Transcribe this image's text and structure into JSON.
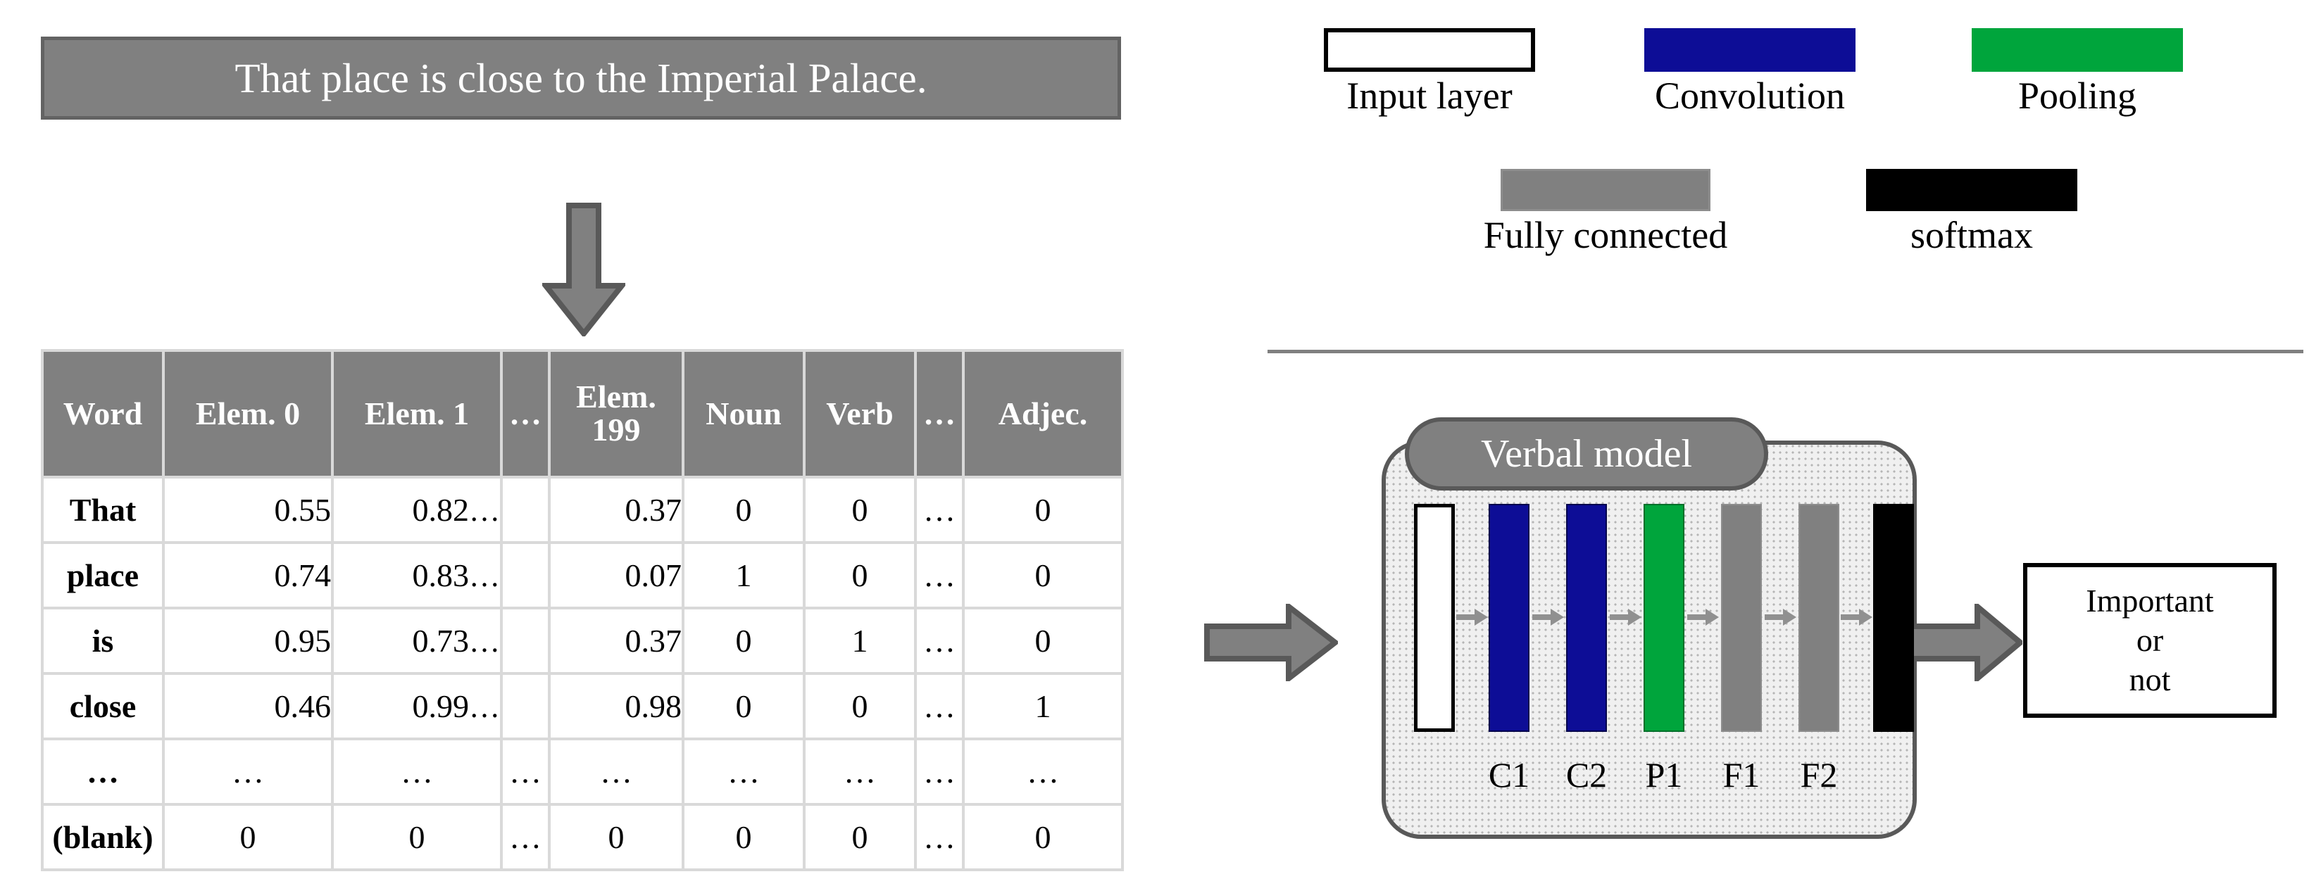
{
  "sentence_box": {
    "text": "That place is close to the Imperial Palace."
  },
  "flow_arrows": {
    "down_arrow": "down-arrow",
    "input_arrow": "right-arrow",
    "output_arrow": "right-arrow"
  },
  "table": {
    "headers": [
      "Word",
      "Elem. 0",
      "Elem. 1",
      "…",
      "Elem. 199",
      "Noun",
      "Verb",
      "…",
      "Adjec."
    ],
    "rows": [
      {
        "word": "That",
        "elem0": "0.55",
        "elem1": "0.82",
        "dots1": "…",
        "elem199": "0.37",
        "noun": "0",
        "verb": "0",
        "dots2": "…",
        "adjec": "0"
      },
      {
        "word": "place",
        "elem0": "0.74",
        "elem1": "0.83",
        "dots1": "…",
        "elem199": "0.07",
        "noun": "1",
        "verb": "0",
        "dots2": "…",
        "adjec": "0"
      },
      {
        "word": "is",
        "elem0": "0.95",
        "elem1": "0.73",
        "dots1": "…",
        "elem199": "0.37",
        "noun": "0",
        "verb": "1",
        "dots2": "…",
        "adjec": "0"
      },
      {
        "word": "close",
        "elem0": "0.46",
        "elem1": "0.99",
        "dots1": "…",
        "elem199": "0.98",
        "noun": "0",
        "verb": "0",
        "dots2": "…",
        "adjec": "1"
      },
      {
        "word": "…",
        "elem0": "…",
        "elem1": "…",
        "dots1": "…",
        "elem199": "…",
        "noun": "…",
        "verb": "…",
        "dots2": "…",
        "adjec": "…"
      },
      {
        "word": "(blank)",
        "elem0": "0",
        "elem1": "0",
        "dots1": "…",
        "elem199": "0",
        "noun": "0",
        "verb": "0",
        "dots2": "…",
        "adjec": "0"
      }
    ],
    "elem1_trailing_dots": "…"
  },
  "legend": {
    "items": [
      {
        "label": "Input layer",
        "color": "#ffffff",
        "swatch": "input-layer-swatch"
      },
      {
        "label": "Convolution",
        "color": "#0d0d96",
        "swatch": "convolution-swatch"
      },
      {
        "label": "Pooling",
        "color": "#00a53c",
        "swatch": "pooling-swatch"
      },
      {
        "label": "Fully connected",
        "color": "#808080",
        "swatch": "fully-connected-swatch"
      },
      {
        "label": "softmax",
        "color": "#000000",
        "swatch": "softmax-swatch"
      }
    ]
  },
  "model": {
    "title": "Verbal model",
    "layers": [
      {
        "name": "Input layer",
        "label": "",
        "color": "#ffffff"
      },
      {
        "name": "Convolution 1",
        "label": "C1",
        "color": "#0d0d96"
      },
      {
        "name": "Convolution 2",
        "label": "C2",
        "color": "#0d0d96"
      },
      {
        "name": "Pooling 1",
        "label": "P1",
        "color": "#00a53c"
      },
      {
        "name": "Fully connected 1",
        "label": "F1",
        "color": "#808080"
      },
      {
        "name": "Fully connected 2",
        "label": "F2",
        "color": "#808080"
      },
      {
        "name": "softmax",
        "label": "",
        "color": "#000000"
      }
    ]
  },
  "result": {
    "lines": [
      "Important",
      "or",
      "not"
    ]
  },
  "colors": {
    "gray": "#808080",
    "gray_border": "#636363",
    "navy": "#0d0d96",
    "green": "#00a53c",
    "black": "#000000",
    "table_grid": "#d9d9d9"
  }
}
